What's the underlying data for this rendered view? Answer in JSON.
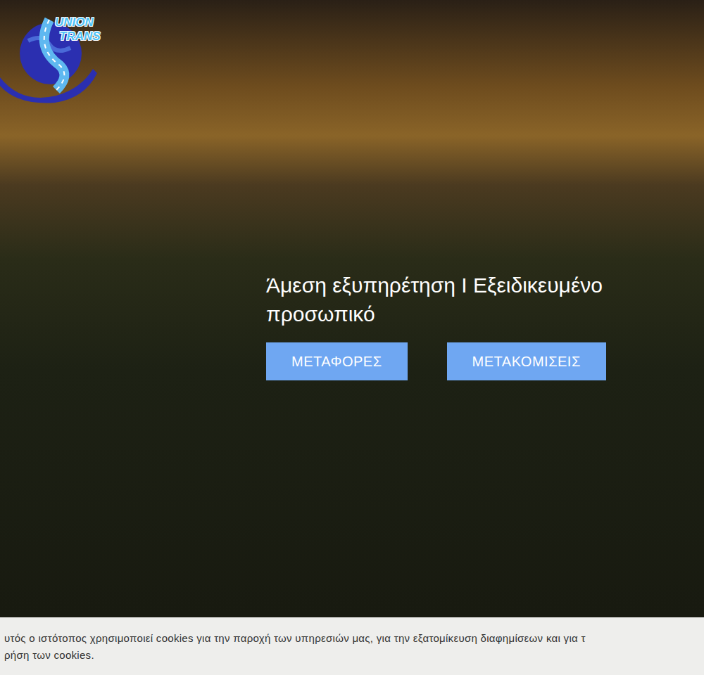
{
  "logo": {
    "line1": "UNION",
    "line2": "TRANS"
  },
  "hero": {
    "title_lines": [
      "Άμεση εξυπηρέτηση Ι Εξειδικευμένο",
      "προσωπικό"
    ],
    "buttons": [
      {
        "label": "ΜΕΤΑΦΟΡΕΣ"
      },
      {
        "label": "ΜΕΤΑΚΟΜΙΣΕΙΣ"
      }
    ]
  },
  "cookie_bar": {
    "lines": [
      "υτός ο ιστότοπος χρησιμοποιεί cookies για την παροχή των υπηρεσιών μας, για την εξατομίκευση διαφημίσεων και για τ",
      "ρήση των cookies."
    ]
  }
}
